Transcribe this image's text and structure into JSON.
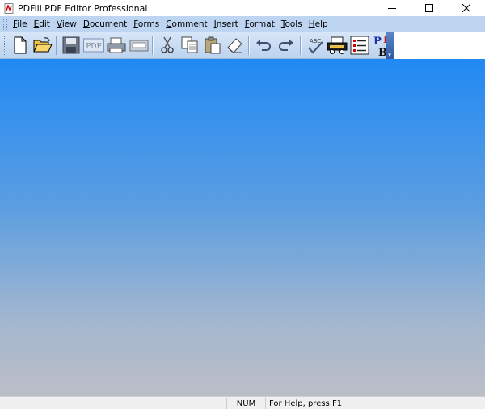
{
  "window": {
    "title": "PDFill PDF Editor Professional",
    "controls": [
      "minimize",
      "maximize",
      "close"
    ]
  },
  "menu": {
    "items": [
      "File",
      "Edit",
      "View",
      "Document",
      "Forms",
      "Comment",
      "Insert",
      "Format",
      "Tools",
      "Help"
    ]
  },
  "toolbar": {
    "buttons": [
      "new-document-icon",
      "open-folder-icon",
      "save-icon",
      "pdf-icon",
      "print-icon",
      "scan-icon",
      "cut-icon",
      "copy-icon",
      "paste-icon",
      "eraser-icon",
      "undo-icon",
      "redo-icon",
      "spell-check-icon",
      "printer-setup-icon",
      "list-icon",
      "peb-icon"
    ],
    "pdf_label": "PDF",
    "spell_label": "ABC",
    "peb_letters": [
      "P",
      "E",
      "B"
    ]
  },
  "statusbar": {
    "num": "NUM",
    "help": "For Help, press F1"
  }
}
